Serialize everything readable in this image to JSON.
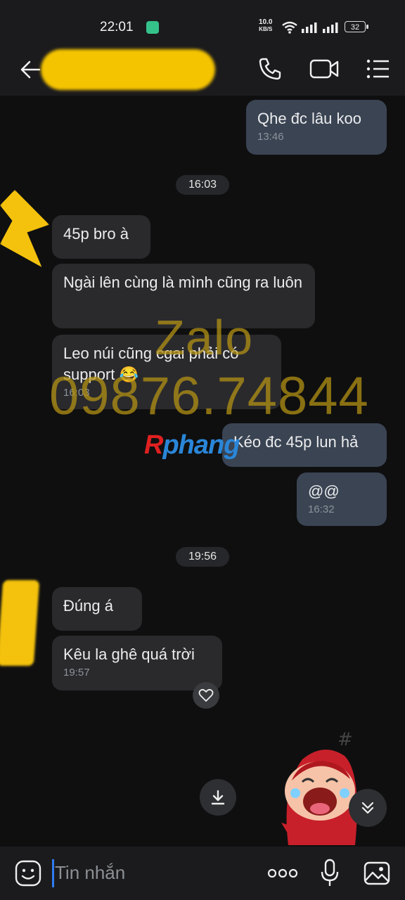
{
  "status": {
    "time": "22:01",
    "net_speed_top": "10.0",
    "net_speed_unit": "KB/S",
    "battery": "32"
  },
  "header": {
    "icons": [
      "back-arrow-icon",
      "phone-icon",
      "video-call-icon",
      "menu-icon"
    ]
  },
  "watermark": {
    "zalo": "Zalo",
    "phone": "09876.74844",
    "brand_r": "R",
    "brand_rest": "phang"
  },
  "messages": [
    {
      "dir": "out",
      "text": "Qhe đc lâu koo",
      "time": "13:46"
    },
    {
      "dir": "in",
      "text": "45p bro à"
    },
    {
      "dir": "in",
      "text": "Ngài lên cùng là mình cũng ra luôn"
    },
    {
      "dir": "in",
      "text": "Leo núi cũng cgai phải có support 😂",
      "time": "16:03"
    },
    {
      "dir": "out",
      "text": "Kéo đc 45p lun hả"
    },
    {
      "dir": "out",
      "text": "@@",
      "time": "16:32"
    },
    {
      "dir": "in",
      "text": "Đúng á"
    },
    {
      "dir": "in",
      "text": "Kêu la ghê quá trời",
      "time": "19:57"
    }
  ],
  "date_separators": [
    "16:03",
    "19:56"
  ],
  "input": {
    "placeholder": "Tin nhắn"
  }
}
